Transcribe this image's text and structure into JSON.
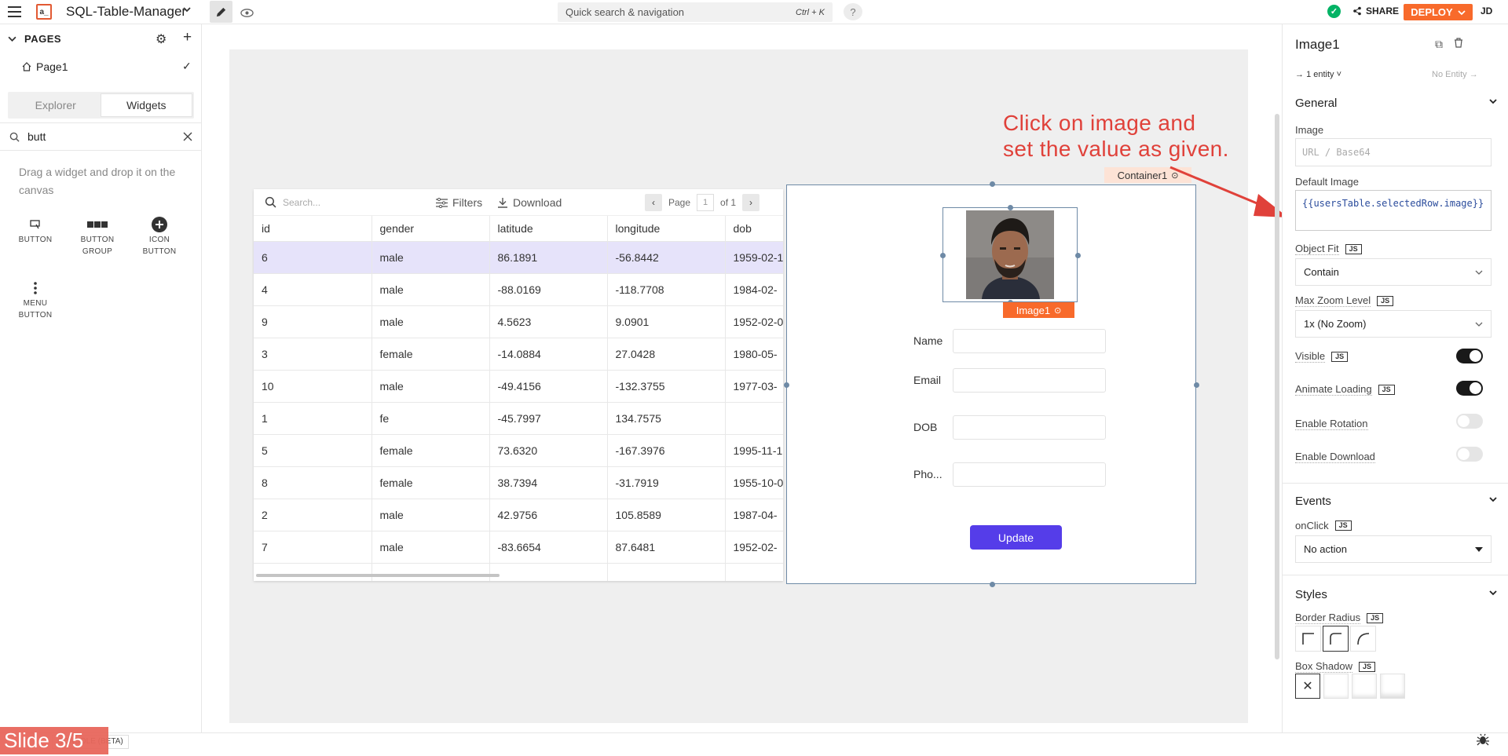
{
  "topbar": {
    "app_name": "SQL-Table-Manager",
    "search_placeholder": "Quick search & navigation",
    "search_shortcut": "Ctrl + K",
    "help_label": "?",
    "share_label": "SHARE",
    "deploy_label": "DEPLOY",
    "user_initials": "JD",
    "logo_text": "a_"
  },
  "left": {
    "pages_title": "PAGES",
    "page_name": "Page1",
    "tab_explorer": "Explorer",
    "tab_widgets": "Widgets",
    "search_value": "butt",
    "hint": "Drag a widget and drop it on the canvas",
    "widgets": [
      "BUTTON",
      "BUTTON GROUP",
      "ICON BUTTON",
      "MENU BUTTON"
    ]
  },
  "table": {
    "search_placeholder": "Search...",
    "filters_label": "Filters",
    "download_label": "Download",
    "page_label": "Page",
    "page_number": "1",
    "page_of": "of 1",
    "columns": [
      "id",
      "gender",
      "latitude",
      "longitude",
      "dob"
    ],
    "rows": [
      [
        "6",
        "male",
        "86.1891",
        "-56.8442",
        "1959-02-1"
      ],
      [
        "4",
        "male",
        "-88.0169",
        "-118.7708",
        "1984-02-"
      ],
      [
        "9",
        "male",
        "4.5623",
        "9.0901",
        "1952-02-0"
      ],
      [
        "3",
        "female",
        "-14.0884",
        "27.0428",
        "1980-05-"
      ],
      [
        "10",
        "male",
        "-49.4156",
        "-132.3755",
        "1977-03-"
      ],
      [
        "1",
        "fe",
        "-45.7997",
        "134.7575",
        ""
      ],
      [
        "5",
        "female",
        "73.6320",
        "-167.3976",
        "1995-11-1"
      ],
      [
        "8",
        "female",
        "38.7394",
        "-31.7919",
        "1955-10-0"
      ],
      [
        "2",
        "male",
        "42.9756",
        "105.8589",
        "1987-04-"
      ],
      [
        "7",
        "male",
        "-83.6654",
        "87.6481",
        "1952-02-"
      ],
      [
        "",
        "",
        "",
        "",
        ""
      ]
    ]
  },
  "container": {
    "tag": "Container1",
    "image_tag": "Image1",
    "fields": [
      "Name",
      "Email",
      "DOB",
      "Pho..."
    ],
    "update_label": "Update"
  },
  "annotation": {
    "line1": "Click on image and",
    "line2": "set the value as given."
  },
  "panel": {
    "title": "Image1",
    "entity": "1 entity",
    "no_entity": "No Entity",
    "general": "General",
    "image_label": "Image",
    "image_placeholder": "URL / Base64",
    "default_image_label": "Default Image",
    "default_image_value": "{{usersTable.selectedRow.image}}",
    "object_fit_label": "Object Fit",
    "object_fit_value": "Contain",
    "max_zoom_label": "Max Zoom Level",
    "max_zoom_value": "1x (No Zoom)",
    "visible_label": "Visible",
    "animate_label": "Animate Loading",
    "rotation_label": "Enable Rotation",
    "download_label": "Enable Download",
    "events": "Events",
    "onclick_label": "onClick",
    "onclick_value": "No action",
    "styles": "Styles",
    "border_radius_label": "Border Radius",
    "box_shadow_label": "Box Shadow",
    "js": "JS",
    "toggles": {
      "visible": true,
      "animate": true,
      "rotation": false,
      "download": false
    }
  },
  "bottom": {
    "console": "CONSOLE (BETA)",
    "slide": "Slide 3/5"
  },
  "colors": {
    "accent": "#f86a2b",
    "primary_button": "#553de9",
    "selected_row": "#e6e3fa",
    "annotation": "#e0413a"
  }
}
